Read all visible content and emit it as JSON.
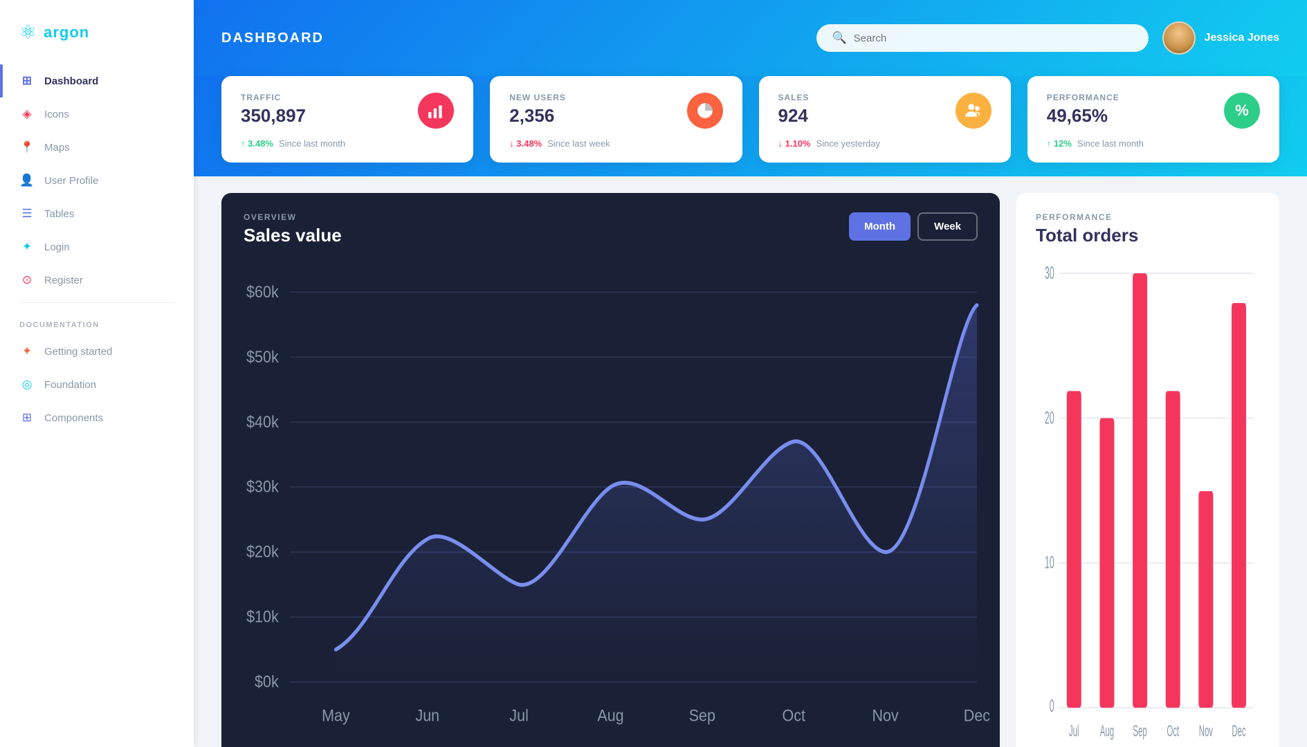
{
  "sidebar": {
    "logo_icon": "⚛",
    "logo_text": "argon",
    "nav_items": [
      {
        "id": "dashboard",
        "label": "Dashboard",
        "icon": "⊞",
        "active": true,
        "color": "#5e72e4"
      },
      {
        "id": "icons",
        "label": "Icons",
        "icon": "◈",
        "active": false,
        "color": "#f5365c"
      },
      {
        "id": "maps",
        "label": "Maps",
        "icon": "📍",
        "active": false,
        "color": "#f5365c"
      },
      {
        "id": "user-profile",
        "label": "User Profile",
        "icon": "👤",
        "active": false,
        "color": "#fbb140"
      },
      {
        "id": "tables",
        "label": "Tables",
        "icon": "☰",
        "active": false,
        "color": "#5e72e4"
      },
      {
        "id": "login",
        "label": "Login",
        "icon": "✦",
        "active": false,
        "color": "#11cdef"
      },
      {
        "id": "register",
        "label": "Register",
        "icon": "⊙",
        "active": false,
        "color": "#f5365c"
      }
    ],
    "documentation_label": "DOCUMENTATION",
    "doc_items": [
      {
        "id": "getting-started",
        "label": "Getting started",
        "icon": "✦",
        "color": "#fb6340"
      },
      {
        "id": "foundation",
        "label": "Foundation",
        "icon": "◎",
        "color": "#11cdef"
      },
      {
        "id": "components",
        "label": "Components",
        "icon": "⊞",
        "color": "#5e72e4"
      }
    ]
  },
  "header": {
    "title": "DASHBOARD",
    "search_placeholder": "Search",
    "user_name": "Jessica Jones"
  },
  "stats": [
    {
      "id": "traffic",
      "label": "TRAFFIC",
      "value": "350,897",
      "icon": "📊",
      "icon_bg": "#f5365c",
      "change": "3.48%",
      "change_dir": "up",
      "since": "Since last month"
    },
    {
      "id": "new-users",
      "label": "NEW USERS",
      "value": "2,356",
      "icon": "🥧",
      "icon_bg": "#fb6340",
      "change": "3.48%",
      "change_dir": "down",
      "since": "Since last week"
    },
    {
      "id": "sales",
      "label": "SALES",
      "value": "924",
      "icon": "👥",
      "icon_bg": "#fbb140",
      "change": "1.10%",
      "change_dir": "down",
      "since": "Since yesterday"
    },
    {
      "id": "performance",
      "label": "PERFORMANCE",
      "value": "49,65%",
      "icon": "%",
      "icon_bg": "#2dce89",
      "change": "12%",
      "change_dir": "up",
      "since": "Since last month"
    }
  ],
  "overview": {
    "label": "OVERVIEW",
    "title": "Sales value",
    "btn_month": "Month",
    "btn_week": "Week",
    "y_labels": [
      "$60k",
      "$50k",
      "$40k",
      "$30k",
      "$20k",
      "$10k",
      "$0k"
    ],
    "x_labels": [
      "May",
      "Jun",
      "Jul",
      "Aug",
      "Sep",
      "Oct",
      "Nov",
      "Dec"
    ],
    "line_data": [
      5,
      22,
      15,
      30,
      25,
      37,
      20,
      58
    ]
  },
  "performance": {
    "label": "PERFORMANCE",
    "title": "Total orders",
    "y_labels": [
      "30",
      "20",
      "10",
      "0"
    ],
    "x_labels": [
      "Jul",
      "Aug",
      "Sep",
      "Oct",
      "Nov",
      "Dec"
    ],
    "bar_data": [
      22,
      20,
      30,
      22,
      15,
      28
    ]
  }
}
